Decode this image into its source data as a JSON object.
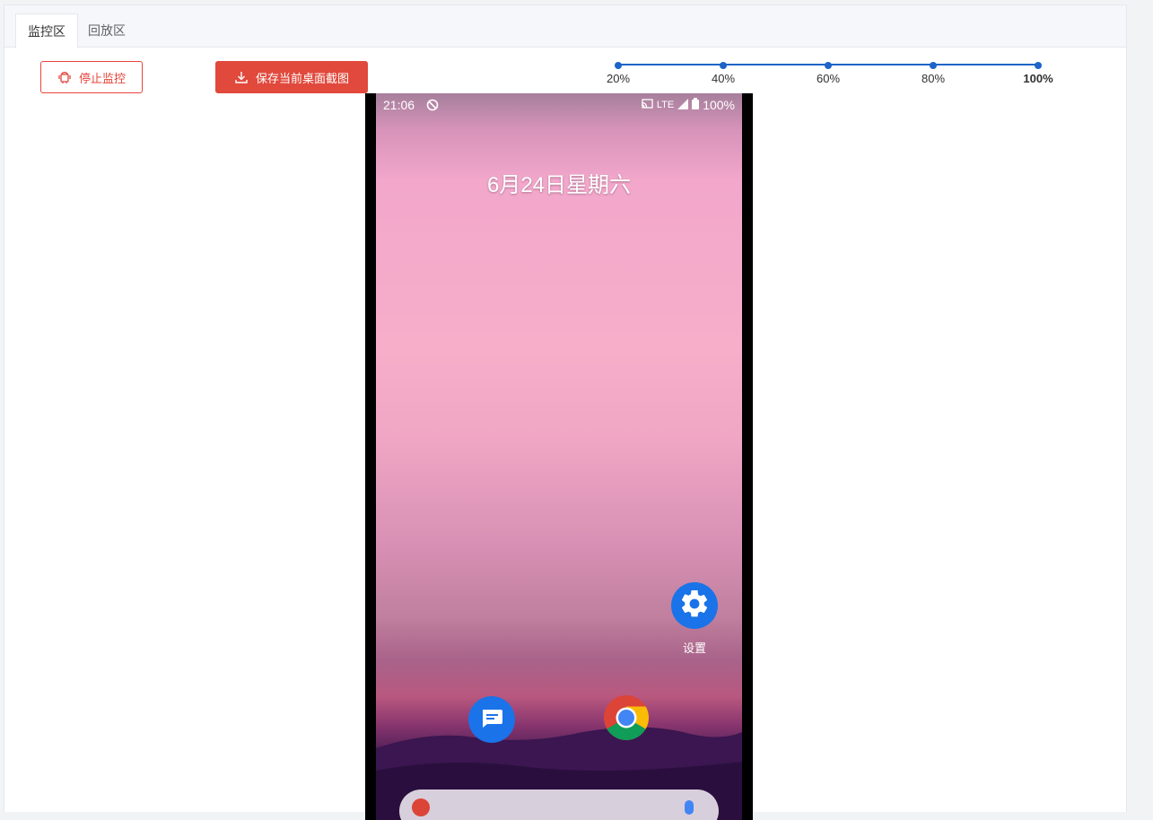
{
  "tabs": [
    {
      "label": "监控区",
      "active": true
    },
    {
      "label": "回放区",
      "active": false
    }
  ],
  "toolbar": {
    "stop_label": "停止监控",
    "save_label": "保存当前桌面截图"
  },
  "zoom": {
    "options": [
      "20%",
      "40%",
      "60%",
      "80%",
      "100%"
    ],
    "selected": "100%"
  },
  "device": {
    "status_time": "21:06",
    "network": "LTE",
    "battery": "100%",
    "date": "6月24日星期六",
    "apps": [
      {
        "label": "设置",
        "icon": "gear-icon"
      }
    ],
    "dock": [
      {
        "icon": "messages-icon"
      },
      {
        "icon": "chrome-icon"
      }
    ]
  },
  "colors": {
    "accent": "#1e64c8",
    "danger": "#e0493c"
  }
}
